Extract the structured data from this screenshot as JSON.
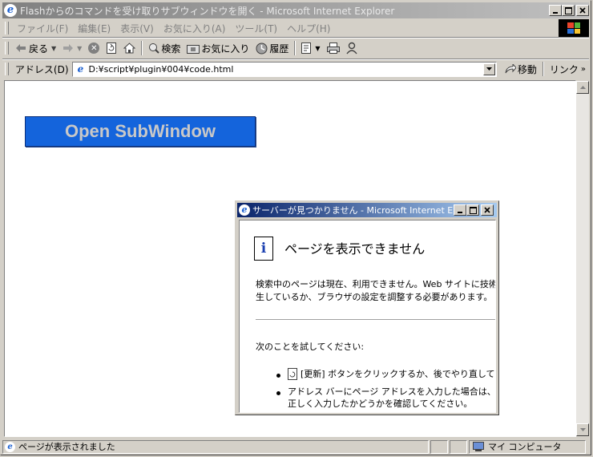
{
  "window": {
    "title": "Flashからのコマンドを受け取りサブウィンドウを開く - Microsoft Internet Explorer"
  },
  "menu": [
    "ファイル(F)",
    "編集(E)",
    "表示(V)",
    "お気に入り(A)",
    "ツール(T)",
    "ヘルプ(H)"
  ],
  "toolbar": {
    "back": "戻る",
    "search": "検索",
    "favorites": "お気に入り",
    "history": "履歴"
  },
  "address": {
    "label": "アドレス(D)",
    "url": "D:¥script¥plugin¥004¥code.html",
    "go": "移動",
    "links": "リンク"
  },
  "page": {
    "flash_button": "Open SubWindow"
  },
  "status": {
    "text": "ページが表示されました",
    "zone": "マイ コンピュータ"
  },
  "dialog": {
    "title": "サーバーが見つかりません - Microsoft Internet Ex...",
    "heading": "ページを表示できません",
    "para1_line1": "検索中のページは現在、利用できません。Web サイトに技術",
    "para1_line2": "生しているか、ブラウザの設定を調整する必要があります。",
    "try_label": "次のことを試してください:",
    "bullet1": "[更新] ボタンをクリックするか、後でやり直してくだ",
    "bullet2_line1": "アドレス バーにページ アドレスを入力した場合は、ペ",
    "bullet2_line2": "正しく入力したかどうかを確認してください。"
  },
  "colors": {
    "flash_button_bg": "#1464dc",
    "dialog_title_active": "#0a246a"
  }
}
